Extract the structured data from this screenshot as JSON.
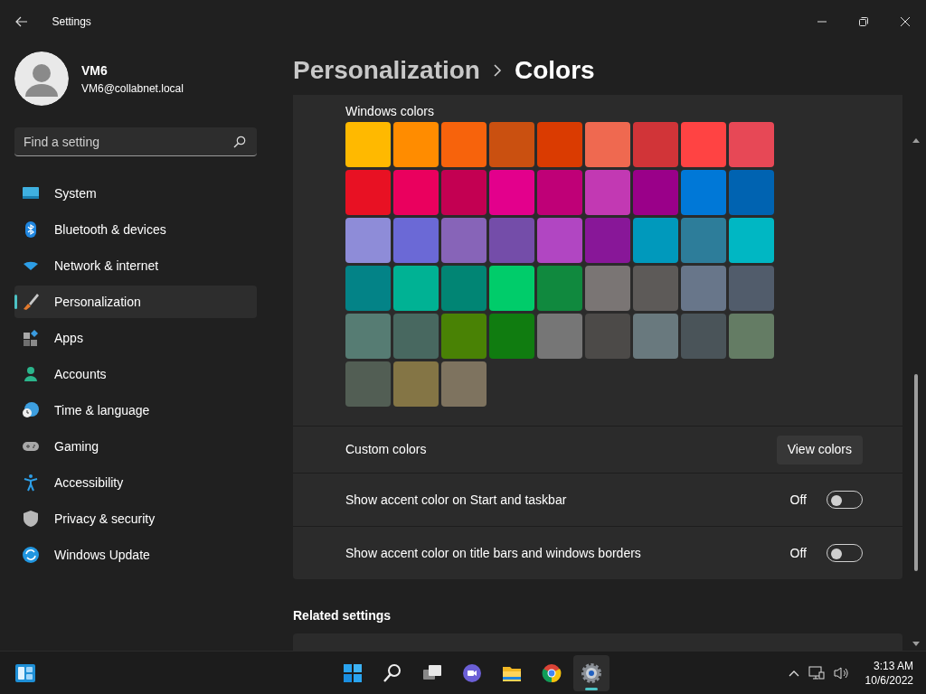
{
  "window": {
    "title": "Settings"
  },
  "profile": {
    "name": "VM6",
    "email": "VM6@collabnet.local"
  },
  "search": {
    "placeholder": "Find a setting"
  },
  "sidebar": {
    "items": [
      {
        "kind": "system",
        "label": "System",
        "selected": false
      },
      {
        "kind": "bluetooth",
        "label": "Bluetooth & devices",
        "selected": false
      },
      {
        "kind": "network",
        "label": "Network & internet",
        "selected": false
      },
      {
        "kind": "brush",
        "label": "Personalization",
        "selected": true
      },
      {
        "kind": "apps",
        "label": "Apps",
        "selected": false
      },
      {
        "kind": "accounts",
        "label": "Accounts",
        "selected": false
      },
      {
        "kind": "time",
        "label": "Time & language",
        "selected": false
      },
      {
        "kind": "gaming",
        "label": "Gaming",
        "selected": false
      },
      {
        "kind": "accessibility",
        "label": "Accessibility",
        "selected": false
      },
      {
        "kind": "privacy",
        "label": "Privacy & security",
        "selected": false
      },
      {
        "kind": "update",
        "label": "Windows Update",
        "selected": false
      }
    ]
  },
  "breadcrumb": [
    {
      "label": "Personalization"
    },
    {
      "label": "Colors"
    }
  ],
  "windows_colors": {
    "label": "Windows colors",
    "swatches": [
      {
        "color": "#ffb900"
      },
      {
        "color": "#ff8c00"
      },
      {
        "color": "#f7630c"
      },
      {
        "color": "#ca5010"
      },
      {
        "color": "#da3b01"
      },
      {
        "color": "#ef6950"
      },
      {
        "color": "#d13438"
      },
      {
        "color": "#ff4343"
      },
      {
        "color": "#e74856"
      },
      {
        "color": "#e81123"
      },
      {
        "color": "#ea005e"
      },
      {
        "color": "#c30052"
      },
      {
        "color": "#e3008c"
      },
      {
        "color": "#bf0077"
      },
      {
        "color": "#c239b3"
      },
      {
        "color": "#9a0089"
      },
      {
        "color": "#0078d7"
      },
      {
        "color": "#0063b1"
      },
      {
        "color": "#8e8cd8"
      },
      {
        "color": "#6b69d6"
      },
      {
        "color": "#8764b8"
      },
      {
        "color": "#744da9"
      },
      {
        "color": "#b146c2"
      },
      {
        "color": "#881798"
      },
      {
        "color": "#0099bc"
      },
      {
        "color": "#2d7d9a"
      },
      {
        "color": "#00b7c3"
      },
      {
        "color": "#038387"
      },
      {
        "color": "#00b294"
      },
      {
        "color": "#018574"
      },
      {
        "color": "#00cc6a"
      },
      {
        "color": "#10893e"
      },
      {
        "color": "#7a7574"
      },
      {
        "color": "#5d5a58"
      },
      {
        "color": "#68768a"
      },
      {
        "color": "#515c6b"
      },
      {
        "color": "#567c73"
      },
      {
        "color": "#486860"
      },
      {
        "color": "#498205"
      },
      {
        "color": "#107c10"
      },
      {
        "color": "#767676"
      },
      {
        "color": "#4c4a48"
      },
      {
        "color": "#69797e"
      },
      {
        "color": "#4a5459"
      },
      {
        "color": "#647c64"
      },
      {
        "color": "#525e54"
      },
      {
        "color": "#847545"
      },
      {
        "color": "#7e735f"
      }
    ]
  },
  "settings": [
    {
      "kind": "button",
      "label": "Custom colors",
      "button": "View colors"
    },
    {
      "kind": "toggle",
      "label": "Show accent color on Start and taskbar",
      "state_text": "Off",
      "on": false
    },
    {
      "kind": "toggle",
      "label": "Show accent color on title bars and windows borders",
      "state_text": "Off",
      "on": false
    }
  ],
  "related_settings": {
    "heading": "Related settings"
  },
  "taskbar": {
    "apps": [
      {
        "kind": "start",
        "selected": false
      },
      {
        "kind": "search",
        "selected": false
      },
      {
        "kind": "taskview",
        "selected": false
      },
      {
        "kind": "chat",
        "selected": false
      },
      {
        "kind": "explorer",
        "selected": false
      },
      {
        "kind": "browser",
        "selected": false
      },
      {
        "kind": "settings",
        "selected": true
      }
    ],
    "clock": {
      "time": "3:13 AM",
      "date": "10/6/2022"
    }
  }
}
